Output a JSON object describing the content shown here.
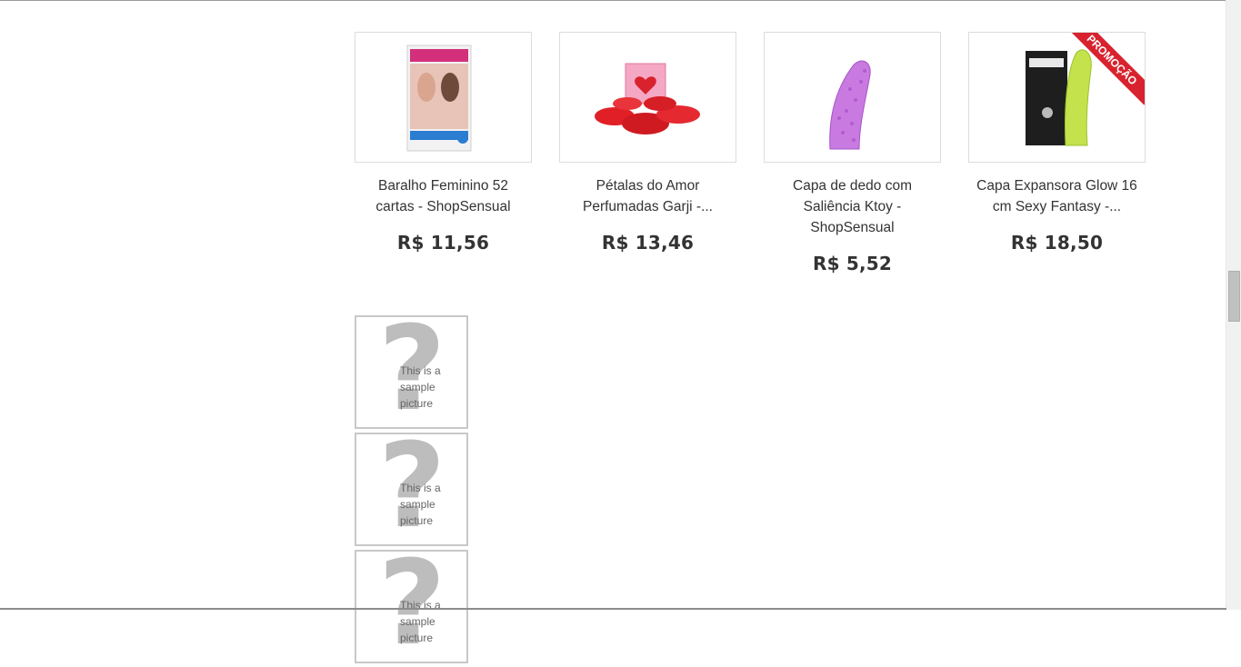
{
  "products": [
    {
      "name": "Baralho Feminino 52 cartas - ShopSensual",
      "price": "R$ 11,56",
      "image_icon": "card-deck-box-image",
      "promo": false
    },
    {
      "name": "Pétalas do Amor Perfumadas Garji -...",
      "price": "R$ 13,46",
      "image_icon": "rose-petals-image",
      "promo": false
    },
    {
      "name": "Capa de dedo com Saliência Ktoy - ShopSensual",
      "price": "R$ 5,52",
      "image_icon": "purple-finger-sleeve-image",
      "promo": false
    },
    {
      "name": "Capa Expansora Glow 16 cm Sexy Fantasy -...",
      "price": "R$ 18,50",
      "image_icon": "glow-sleeve-box-image",
      "promo": true,
      "promo_label": "PROMOÇÃO"
    }
  ],
  "samples": [
    {
      "text": "This is a sample picture"
    },
    {
      "text": "This is a sample picture"
    },
    {
      "text": "This is a sample picture"
    }
  ],
  "colors": {
    "promo_ribbon": "#d8222e",
    "border": "#dcdcdc",
    "sample_border": "#c8c8c8",
    "text": "#333333"
  }
}
